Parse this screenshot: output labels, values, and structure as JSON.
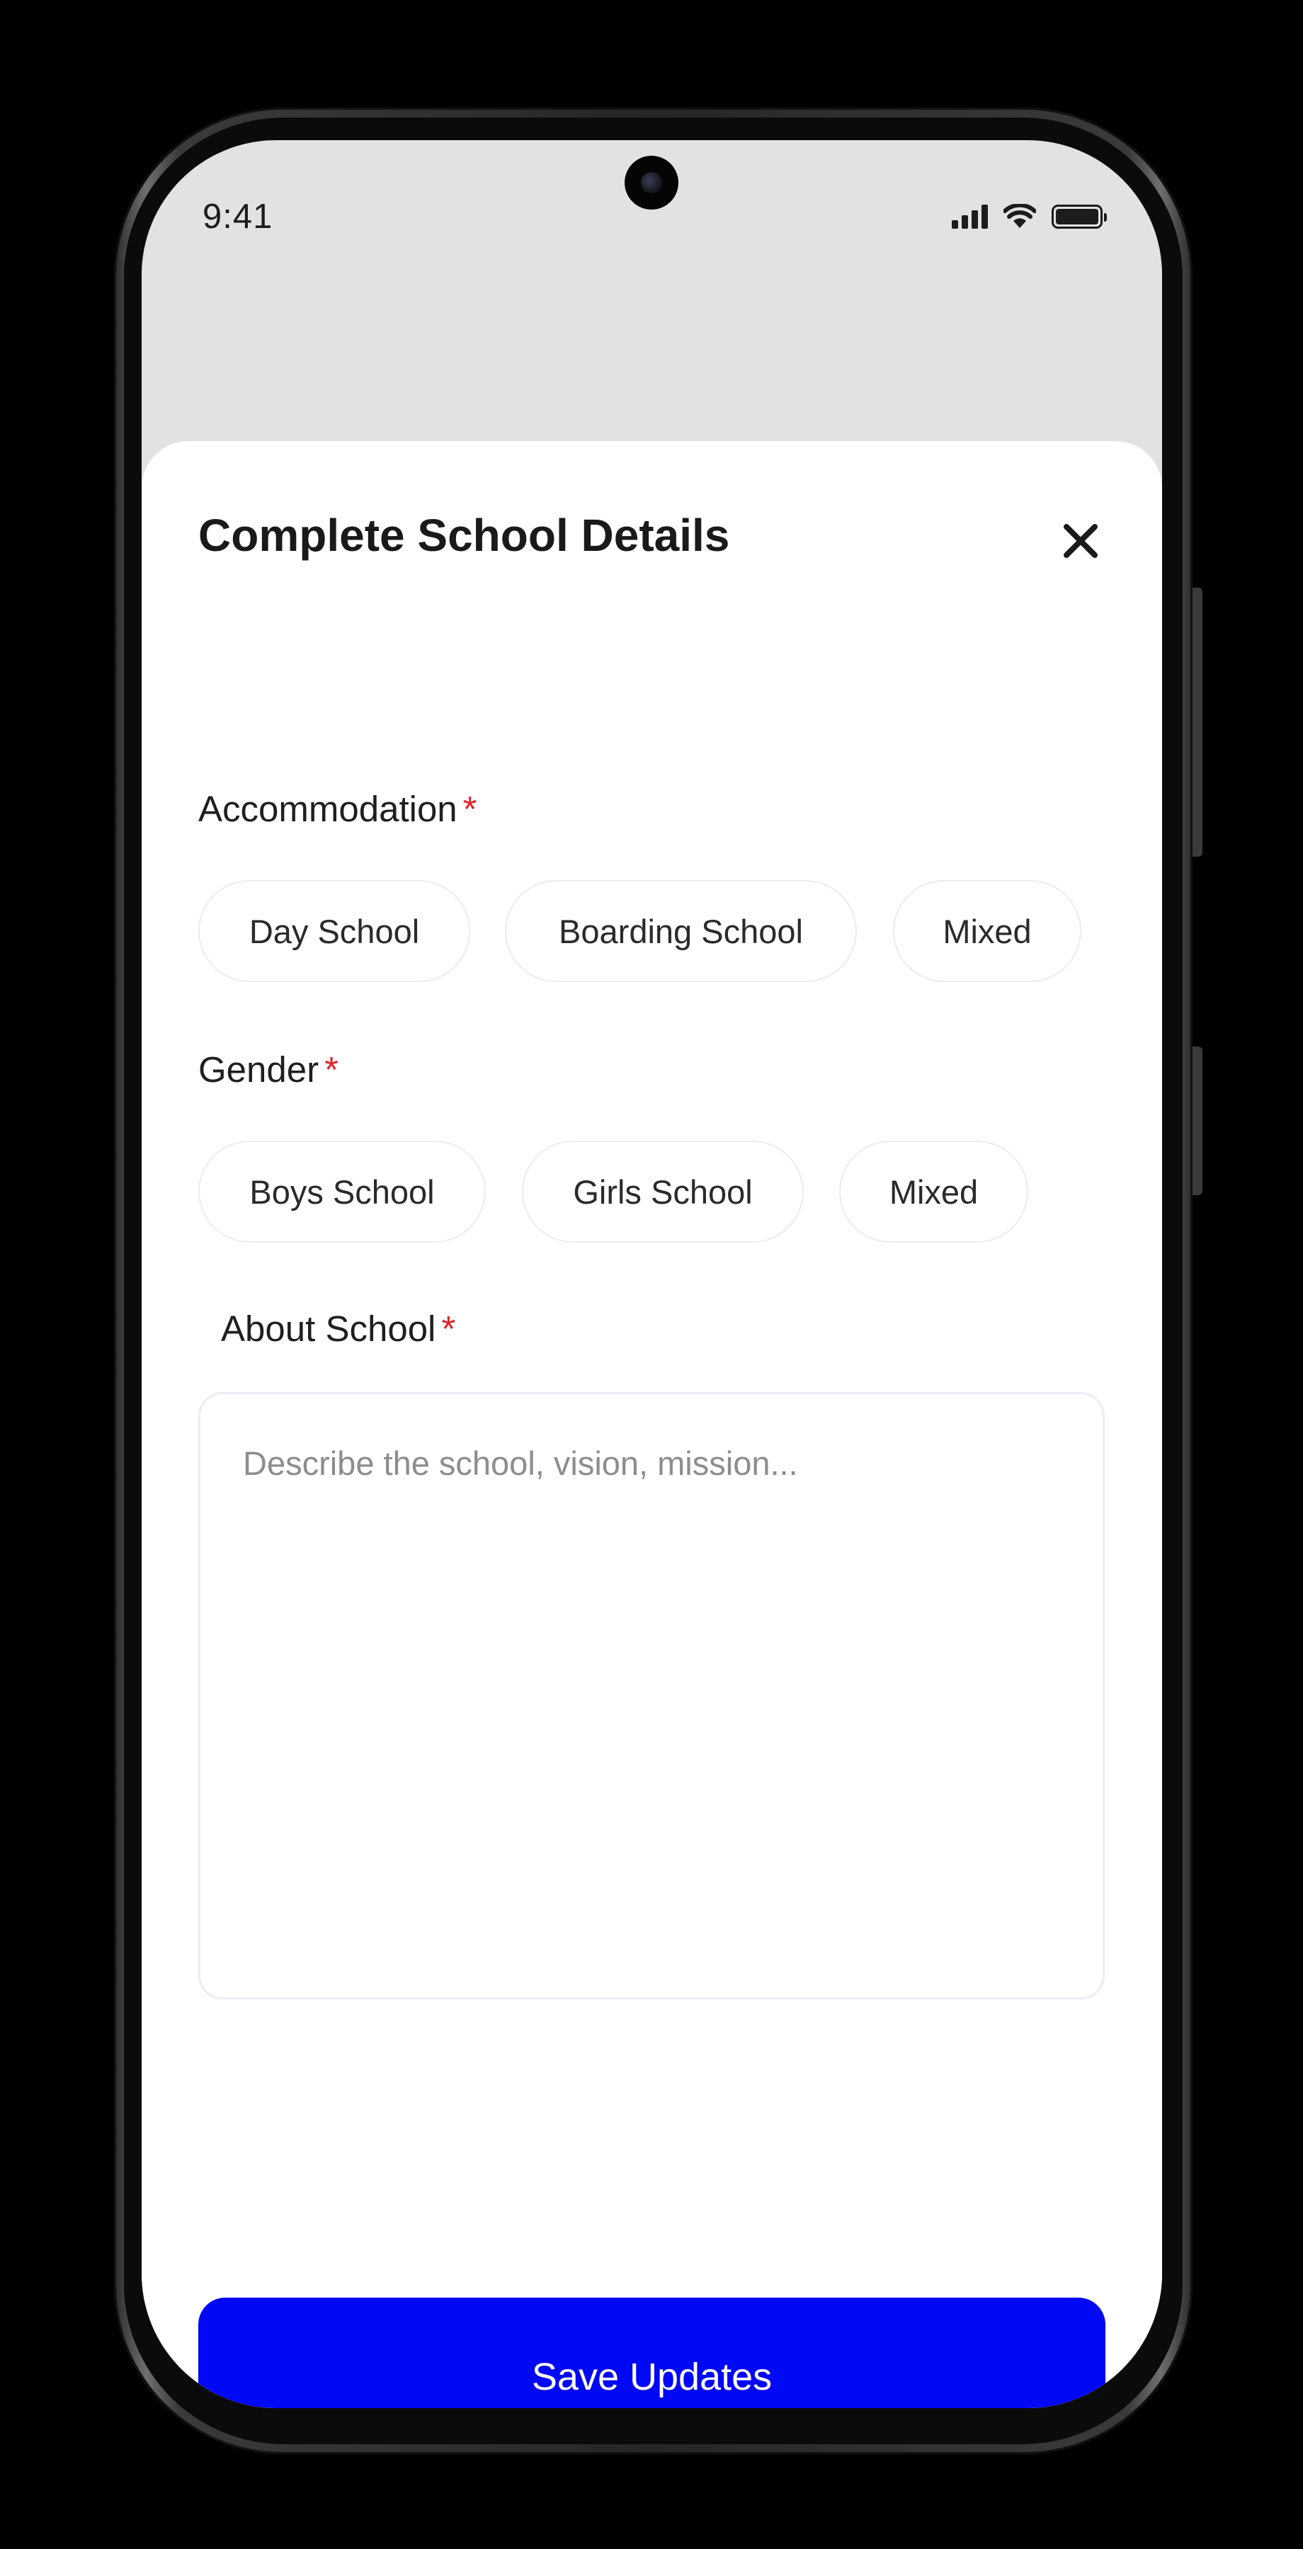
{
  "status_bar": {
    "time": "9:41",
    "icons": [
      "signal-icon",
      "wifi-icon",
      "battery-icon"
    ]
  },
  "sheet": {
    "title": "Complete School Details",
    "close_icon": "close-icon"
  },
  "accommodation": {
    "label": "Accommodation",
    "required_mark": "*",
    "options": [
      "Day School",
      "Boarding School",
      "Mixed"
    ]
  },
  "gender": {
    "label": "Gender",
    "required_mark": "*",
    "options": [
      "Boys School",
      "Girls School",
      "Mixed"
    ]
  },
  "about": {
    "label": "About School",
    "required_mark": "*",
    "value": "",
    "placeholder": "Describe the school, vision, mission..."
  },
  "actions": {
    "save_label": "Save Updates"
  },
  "colors": {
    "primary": "#0008f5",
    "required": "#e0262a",
    "backdrop": "#e2e2e2",
    "sheet": "#ffffff",
    "chip_border": "#ececec"
  }
}
